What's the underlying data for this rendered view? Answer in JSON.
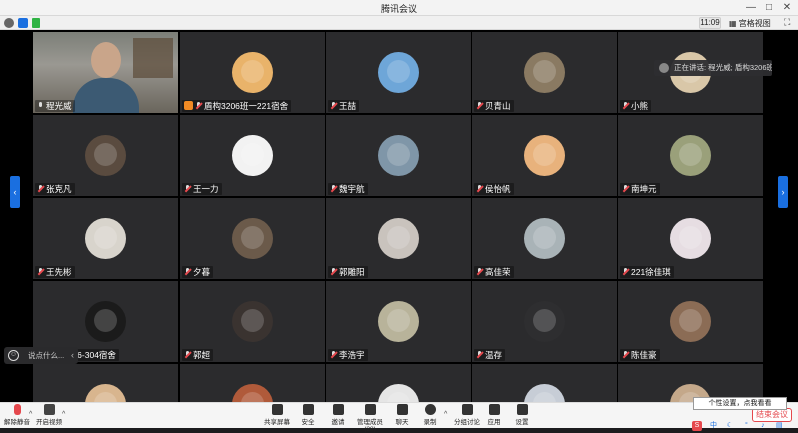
{
  "window": {
    "title": "腾讯会议"
  },
  "topbar": {
    "time": "11:09",
    "grid_view_label": "宫格视图"
  },
  "participants": [
    {
      "name": "程光威",
      "type": "video",
      "muted": false
    },
    {
      "name": "盾构3206班一221宿舍",
      "type": "avatar",
      "host": true,
      "color": "#e9b36a"
    },
    {
      "name": "王喆",
      "type": "avatar",
      "color": "#6ea6d8"
    },
    {
      "name": "贝青山",
      "type": "avatar",
      "color": "#8a7a62"
    },
    {
      "name": "小熊",
      "type": "avatar",
      "color": "#d9c7a8"
    },
    {
      "name": "张克凡",
      "type": "avatar",
      "color": "#5a4b3f"
    },
    {
      "name": "王一力",
      "type": "avatar",
      "color": "#f2f2f2"
    },
    {
      "name": "魏宇航",
      "type": "avatar",
      "color": "#7f96a8"
    },
    {
      "name": "侯怡帆",
      "type": "avatar",
      "color": "#e8b27c"
    },
    {
      "name": "南坤元",
      "type": "avatar",
      "color": "#9aa07a"
    },
    {
      "name": "王先彬",
      "type": "avatar",
      "color": "#d8d4cc"
    },
    {
      "name": "夕暮",
      "type": "avatar",
      "color": "#6b5a4a"
    },
    {
      "name": "郭雕阳",
      "type": "avatar",
      "color": "#c9c3bd"
    },
    {
      "name": "高佳荣",
      "type": "avatar",
      "color": "#a9b3b7"
    },
    {
      "name": "221徐佳琪",
      "type": "avatar",
      "color": "#e6dde2"
    },
    {
      "name": "盾构3206-304宿舍",
      "type": "avatar",
      "color": "#1b1b1b"
    },
    {
      "name": "郭超",
      "type": "avatar",
      "color": "#3a3330"
    },
    {
      "name": "李浩宇",
      "type": "avatar",
      "color": "#b8b39a"
    },
    {
      "name": "温存",
      "type": "avatar",
      "color": "#2e2e30"
    },
    {
      "name": "陈佳豪",
      "type": "avatar",
      "color": "#8b6c55"
    },
    {
      "name": "",
      "type": "avatar",
      "color": "#d8b58e"
    },
    {
      "name": "",
      "type": "avatar",
      "color": "#b05a3a"
    },
    {
      "name": "",
      "type": "avatar",
      "color": "#e5e5e5"
    },
    {
      "name": "",
      "type": "avatar",
      "color": "#c7cdd6"
    },
    {
      "name": "",
      "type": "avatar",
      "color": "#c4a88a"
    }
  ],
  "speaking": {
    "text": "正在讲话: 程光威; 盾构3206班..."
  },
  "chat": {
    "placeholder": "说点什么..."
  },
  "toolbar": {
    "unmute": "解除静音",
    "start_video": "开启视频",
    "share": "共享屏幕",
    "security": "安全",
    "invite": "邀请",
    "members": "管理成员(28)",
    "chat": "聊天",
    "record": "录制",
    "breakout": "分组讨论",
    "apps": "应用",
    "settings": "设置",
    "leave": "结束会议",
    "tooltip": "个性设置，点我看看"
  },
  "colors": {
    "accent": "#1a6fe0",
    "leave": "#e5484d",
    "host_badge": "#f08a24"
  }
}
